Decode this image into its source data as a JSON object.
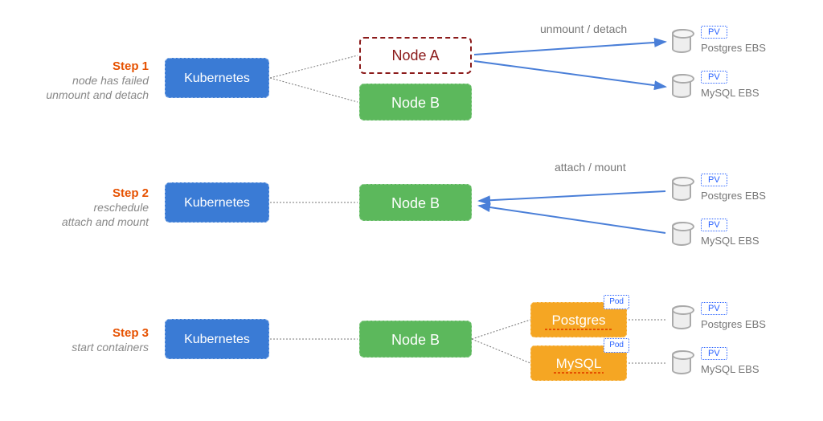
{
  "step1": {
    "title": "Step 1",
    "sub1": "node has failed",
    "sub2": "unmount and detach",
    "op": "unmount / detach"
  },
  "step2": {
    "title": "Step 2",
    "sub1": "reschedule",
    "sub2": "attach and mount",
    "op": "attach / mount"
  },
  "step3": {
    "title": "Step 3",
    "sub1": "start containers"
  },
  "common": {
    "kubernetes": "Kubernetes",
    "nodeA": "Node A",
    "nodeB": "Node B",
    "pv": "PV",
    "pod": "Pod",
    "postgres": "Postgres",
    "mysql": "MySQL",
    "postgresEbs": "Postgres EBS",
    "mysqlEbs": "MySQL EBS"
  }
}
